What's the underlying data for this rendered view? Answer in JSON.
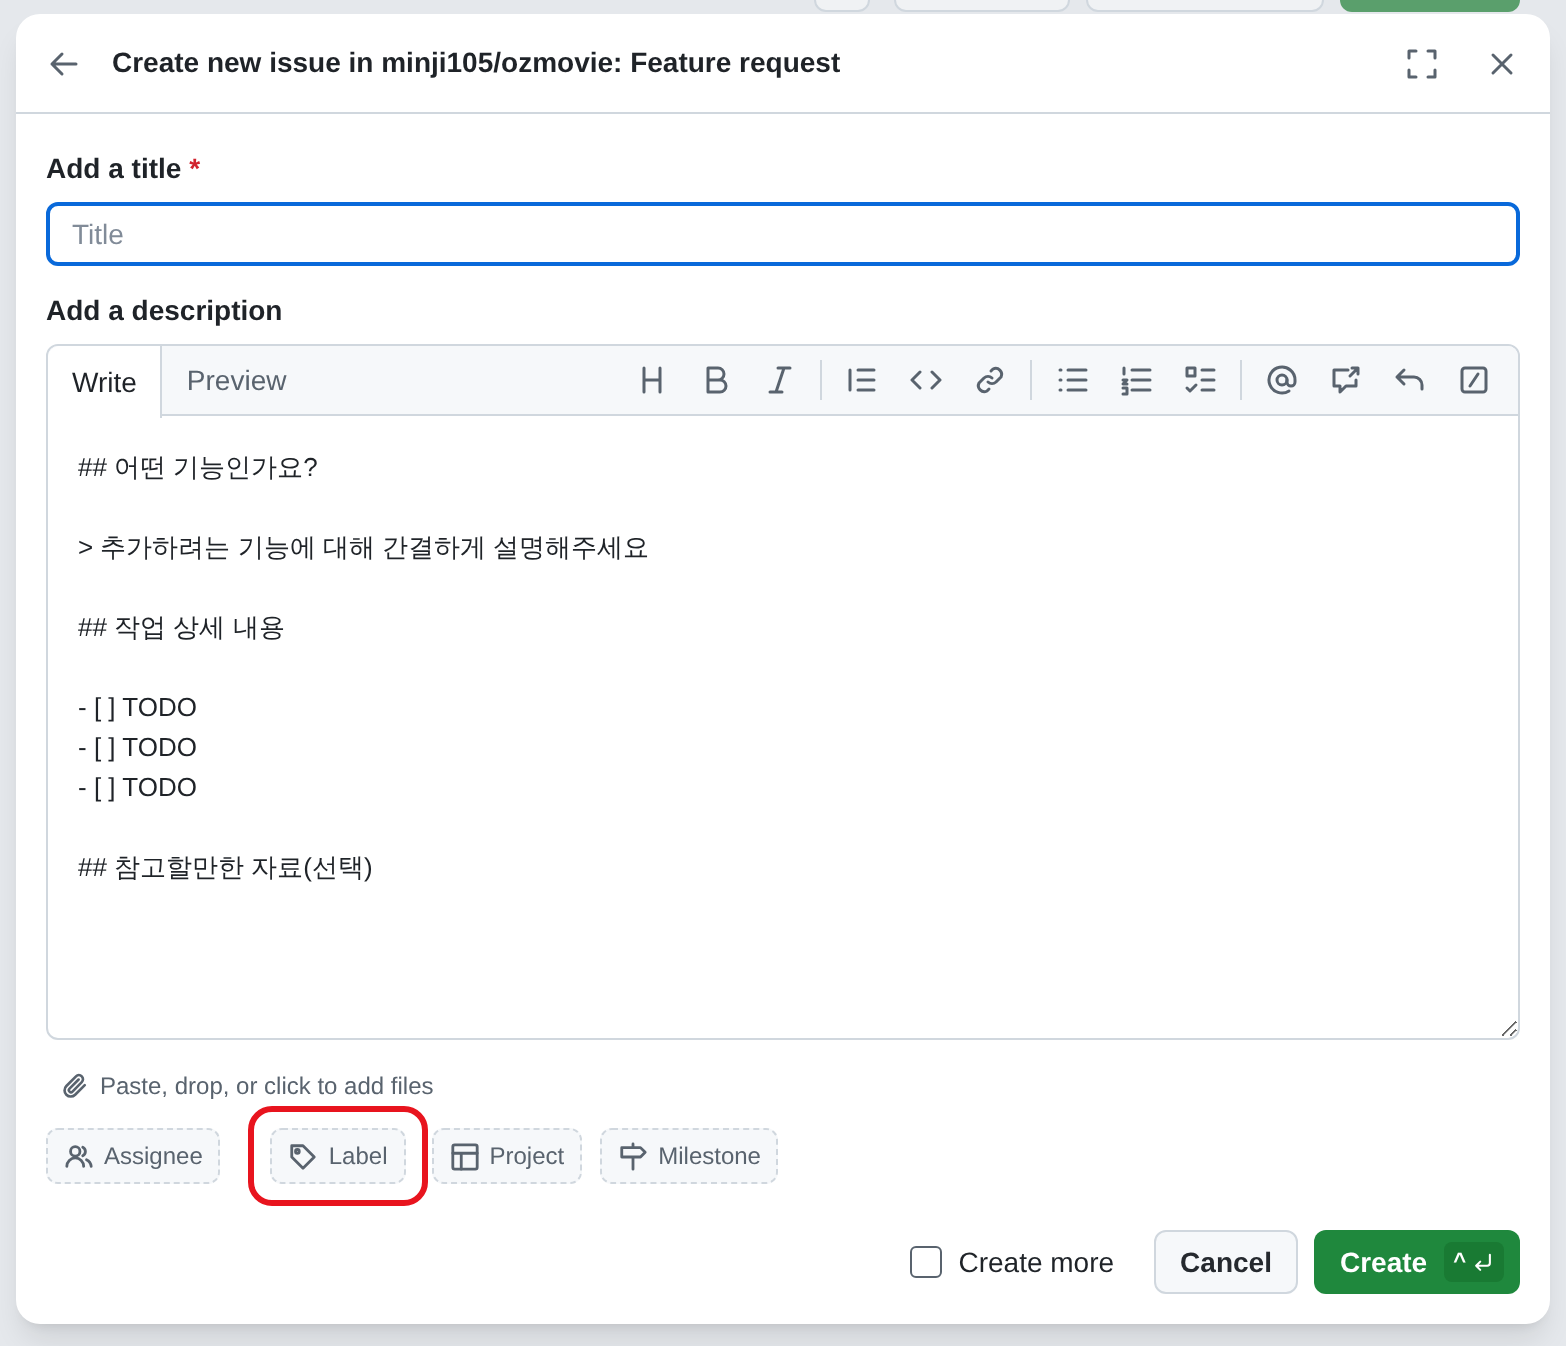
{
  "dialog": {
    "title": "Create new issue in minji105/ozmovie: Feature request"
  },
  "title_field": {
    "label": "Add a title",
    "required_mark": "*",
    "placeholder": "Title"
  },
  "description": {
    "label": "Add a description",
    "tabs": [
      {
        "label": "Write",
        "selected": true
      },
      {
        "label": "Preview",
        "selected": false
      }
    ],
    "value": "## 어떤 기능인가요?\n\n> 추가하려는 기능에 대해 간결하게 설명해주세요\n\n## 작업 상세 내용\n\n- [ ] TODO\n- [ ] TODO\n- [ ] TODO\n\n## 참고할만한 자료(선택)",
    "attach_hint": "Paste, drop, or click to add files"
  },
  "metadata_buttons": [
    {
      "kind": "assignee",
      "label": "Assignee",
      "highlighted": false
    },
    {
      "kind": "label",
      "label": "Label",
      "highlighted": true
    },
    {
      "kind": "project",
      "label": "Project",
      "highlighted": false
    },
    {
      "kind": "milestone",
      "label": "Milestone",
      "highlighted": false
    }
  ],
  "footer": {
    "create_more": {
      "label": "Create more",
      "checked": false
    },
    "cancel": "Cancel",
    "create": "Create",
    "shortcut": "^"
  }
}
